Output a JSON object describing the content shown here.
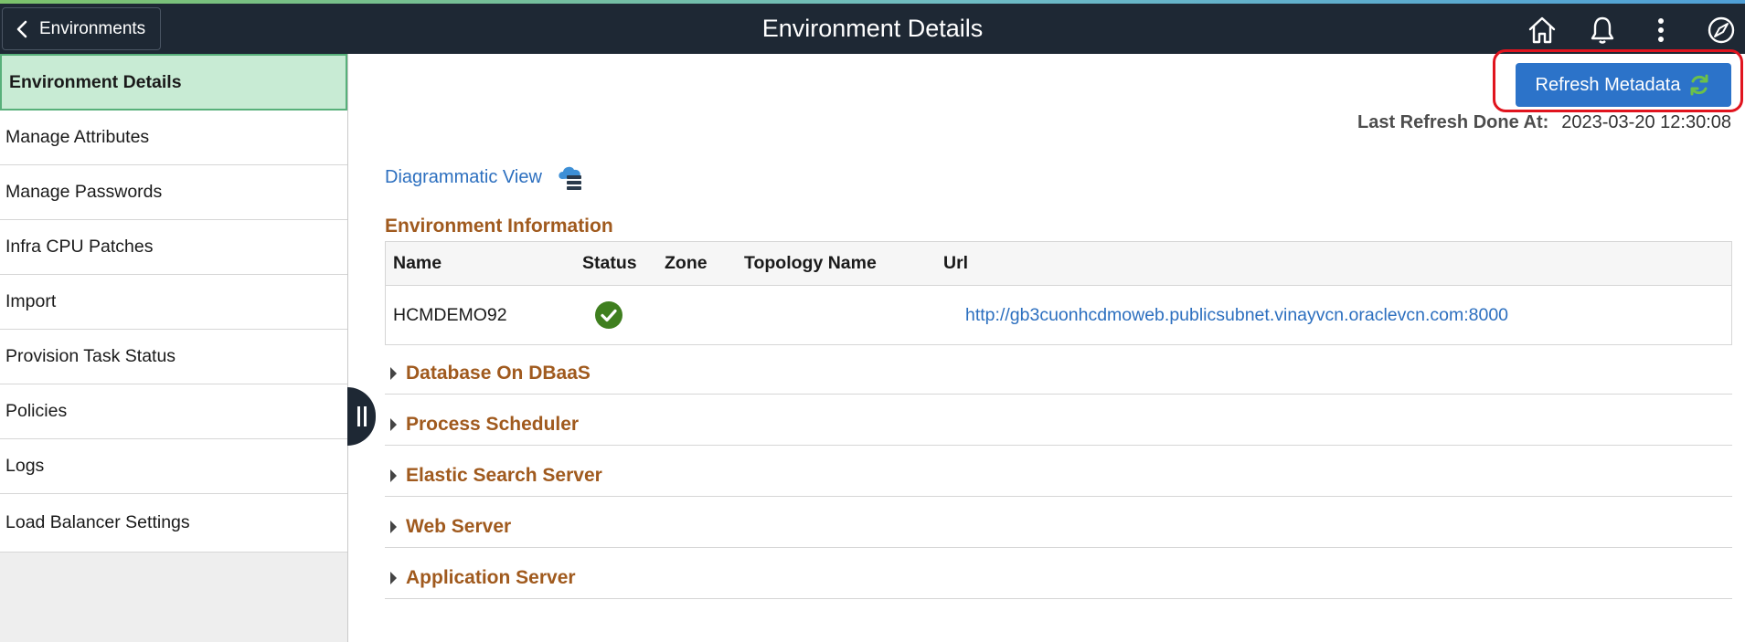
{
  "header": {
    "back_label": "Environments",
    "title": "Environment Details",
    "icons": [
      "home-icon",
      "bell-icon",
      "more-vertical-icon",
      "compass-icon"
    ]
  },
  "sidebar": {
    "items": [
      {
        "label": "Environment Details",
        "active": true
      },
      {
        "label": "Manage Attributes"
      },
      {
        "label": "Manage Passwords"
      },
      {
        "label": "Infra CPU Patches"
      },
      {
        "label": "Import"
      },
      {
        "label": "Provision Task Status"
      },
      {
        "label": "Policies"
      },
      {
        "label": "Logs"
      },
      {
        "label": "Load Balancer Settings"
      }
    ]
  },
  "main": {
    "refresh_button": "Refresh Metadata",
    "last_refresh_label": "Last Refresh Done At:",
    "last_refresh_value": "2023-03-20 12:30:08",
    "diagrammatic_view": "Diagrammatic View",
    "env_info_title": "Environment Information",
    "table": {
      "columns": [
        "Name",
        "Status",
        "Zone",
        "Topology Name",
        "Url"
      ],
      "rows": [
        {
          "name": "HCMDEMO92",
          "status": "check-circle-icon",
          "zone": "",
          "topology": "",
          "url": "http://gb3cuonhcdmoweb.publicsubnet.vinayvcn.oraclevcn.com:8000"
        }
      ]
    },
    "groups": [
      "Database On DBaaS",
      "Process Scheduler",
      "Elastic Search Server",
      "Web Server",
      "Application Server"
    ]
  },
  "colors": {
    "header_bg": "#1e2834",
    "accent_blue": "#2c73c9",
    "section_orange": "#a05a1e",
    "active_green": "#c8ebd4",
    "highlight_red": "#e0141e"
  }
}
